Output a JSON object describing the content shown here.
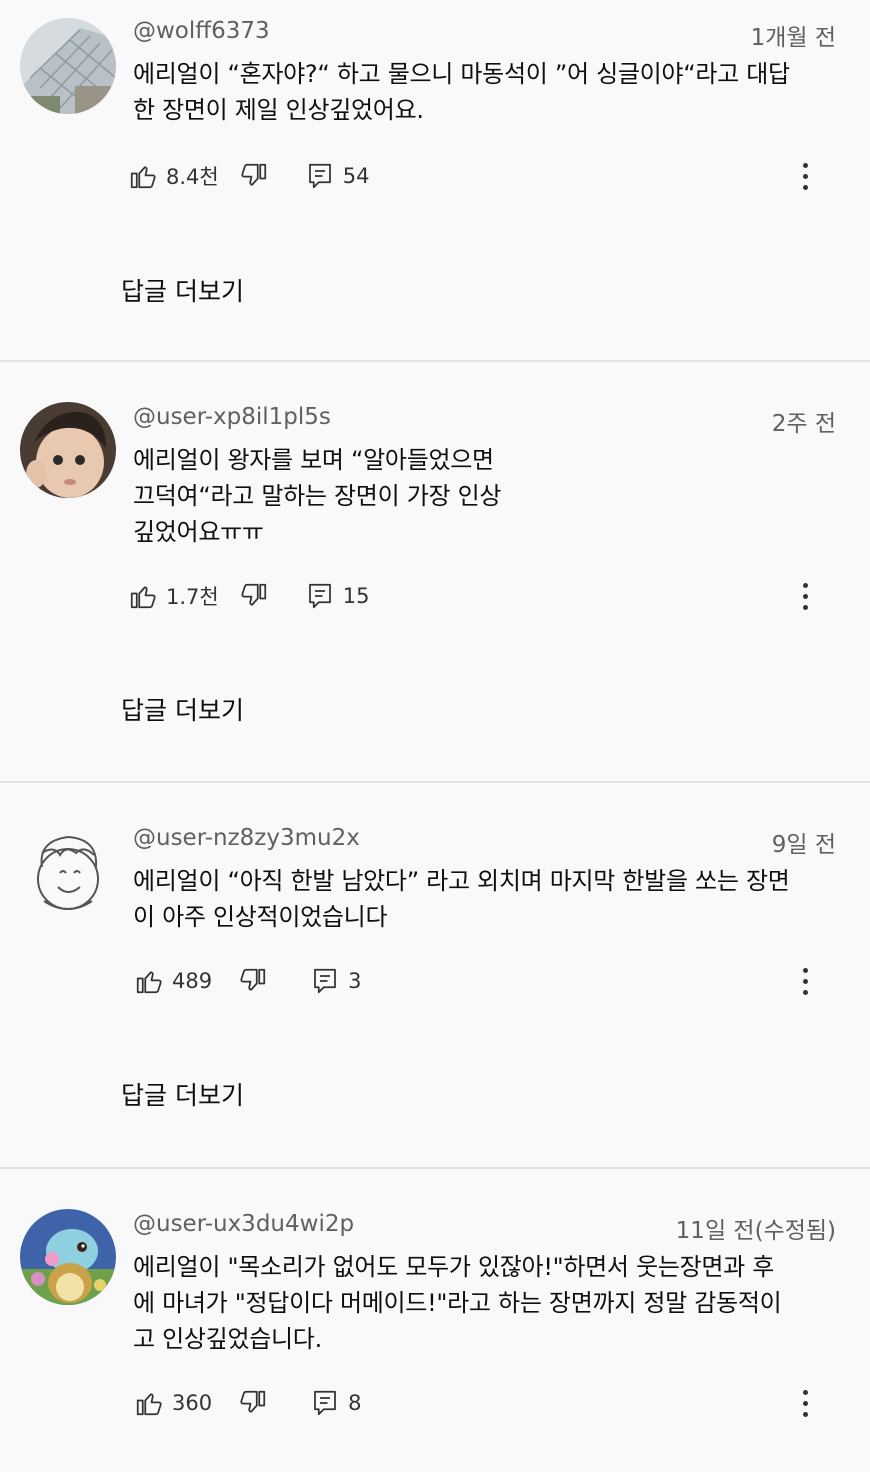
{
  "comments": [
    {
      "author": "@wolff6373",
      "time": "1개월 전",
      "text": "에리얼이 “혼자야?“ 하고 물으니 마동석이 ”어 싱글이야“라고 대답\n한 장면이 제일 인상깊었어요.",
      "likes": "8.4천",
      "reply_count": "54",
      "replies_label": "답글 더보기",
      "avatar_icon": "glass-building-avatar"
    },
    {
      "author": "@user-xp8il1pl5s",
      "time": "2주 전",
      "text": "에리얼이 왕자를 보며 “알아들었으면\n끄덕여“라고 말하는 장면이 가장 인상\n깊었어요ㅠㅠ",
      "likes": "1.7천",
      "reply_count": "15",
      "replies_label": "답글 더보기",
      "avatar_icon": "baby-face-avatar"
    },
    {
      "author": "@user-nz8zy3mu2x",
      "time": "9일 전",
      "text": "에리얼이 “아직 한발 남았다” 라고 외치며 마지막 한발을 쏘는 장면\n이 아주 인상적이었습니다",
      "likes": "489",
      "reply_count": "3",
      "replies_label": "답글 더보기",
      "avatar_icon": "smiley-drawing-avatar"
    },
    {
      "author": "@user-ux3du4wi2p",
      "time": "11일 전(수정됨)",
      "text": "에리얼이 \"목소리가 없어도 모두가 있잖아!\"하면서 웃는장면과 후\n에 마녀가 \"정답이다 머메이드!\"라고 하는 장면까지 정말 감동적이\n고 인상깊었습니다.",
      "likes": "360",
      "reply_count": "8"
    }
  ],
  "colors": {
    "background": "#f9f9f9",
    "meta_text": "#606060",
    "divider": "#e3e3e3"
  }
}
